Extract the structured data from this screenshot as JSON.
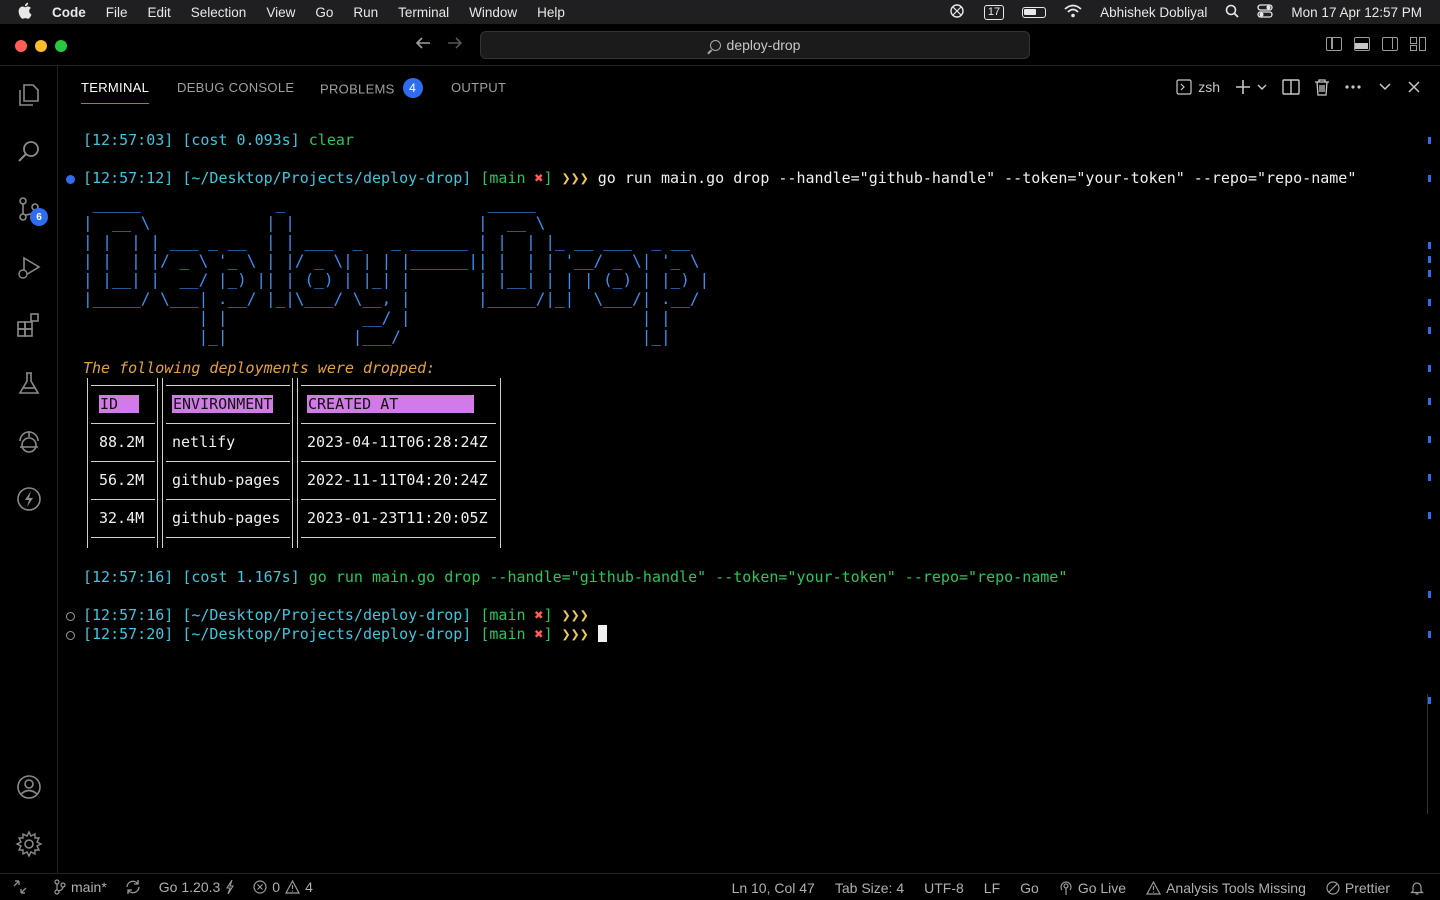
{
  "menubar": {
    "app": "Code",
    "items": [
      "File",
      "Edit",
      "Selection",
      "View",
      "Go",
      "Run",
      "Terminal",
      "Window",
      "Help"
    ],
    "calendar_badge": "17",
    "user": "Abhishek Dobliyal",
    "datetime": "Mon 17 Apr  12:57 PM"
  },
  "titlebar": {
    "search_text": "deploy-drop"
  },
  "activity": {
    "scm_badge": "6"
  },
  "panel": {
    "tabs": {
      "terminal": "TERMINAL",
      "debug": "DEBUG CONSOLE",
      "problems": "PROBLEMS",
      "problems_count": "4",
      "output": "OUTPUT"
    },
    "shell": "zsh"
  },
  "terminal": {
    "line1": {
      "time": "[12:57:03]",
      "cost": "[cost 0.093s]",
      "cmd": "clear"
    },
    "line2": {
      "time": "[12:57:12]",
      "path": "[~/Desktop/Projects/deploy-drop]",
      "branch_open": "[main ",
      "branch_mark": "✖",
      "branch_close": "]",
      "arrows": "❯❯❯",
      "cmd": "go run main.go drop --handle=\"github-handle\" --token=\"your-token\" --repo=\"repo-name\""
    },
    "ascii_art": " _____              _                     _____\n|  __ \\            | |                   |  __ \\\n| |  | | ___ _ __  | | ___  _   _ ______ | |  | |_ __ ___  _ __\n| |  | |/ _ \\ '_ \\ | |/ _ \\| | | |______|| |  | | '__/ _ \\| '_ \\\n| |__| |  __/ |_) || | (_) | |_| |       | |__| | | | (_) | |_) |\n|_____/ \\___| .__/ |_|\\___/ \\__, |       |_____/|_|  \\___/| .__/\n            | |              __/ |                        | |\n            |_|             |___/                         |_|",
    "message": "The following deployments were dropped:",
    "table": {
      "headers": [
        "ID",
        "ENVIRONMENT",
        "CREATED AT"
      ],
      "rows": [
        [
          "88.2M",
          "netlify",
          "2023-04-11T06:28:24Z"
        ],
        [
          "56.2M",
          "github-pages",
          "2022-11-11T04:20:24Z"
        ],
        [
          "32.4M",
          "github-pages",
          "2023-01-23T11:20:05Z"
        ]
      ]
    },
    "line3": {
      "time": "[12:57:16]",
      "cost": "[cost 1.167s]",
      "cmd": "go run main.go drop --handle=\"github-handle\" --token=\"your-token\" --repo=\"repo-name\""
    },
    "line4": {
      "time": "[12:57:16]",
      "path": "[~/Desktop/Projects/deploy-drop]",
      "branch_open": "[main ",
      "branch_mark": "✖",
      "branch_close": "]",
      "arrows": "❯❯❯"
    },
    "line5": {
      "time": "[12:57:20]",
      "path": "[~/Desktop/Projects/deploy-drop]",
      "branch_open": "[main ",
      "branch_mark": "✖",
      "branch_close": "]",
      "arrows": "❯❯❯"
    }
  },
  "statusbar": {
    "branch": "main*",
    "go_version": "Go 1.20.3",
    "errors": "0",
    "warnings": "4",
    "position": "Ln 10, Col 47",
    "tab_size": "Tab Size: 4",
    "encoding": "UTF-8",
    "eol": "LF",
    "language": "Go",
    "go_live": "Go Live",
    "analysis": "Analysis Tools Missing",
    "prettier": "Prettier"
  }
}
